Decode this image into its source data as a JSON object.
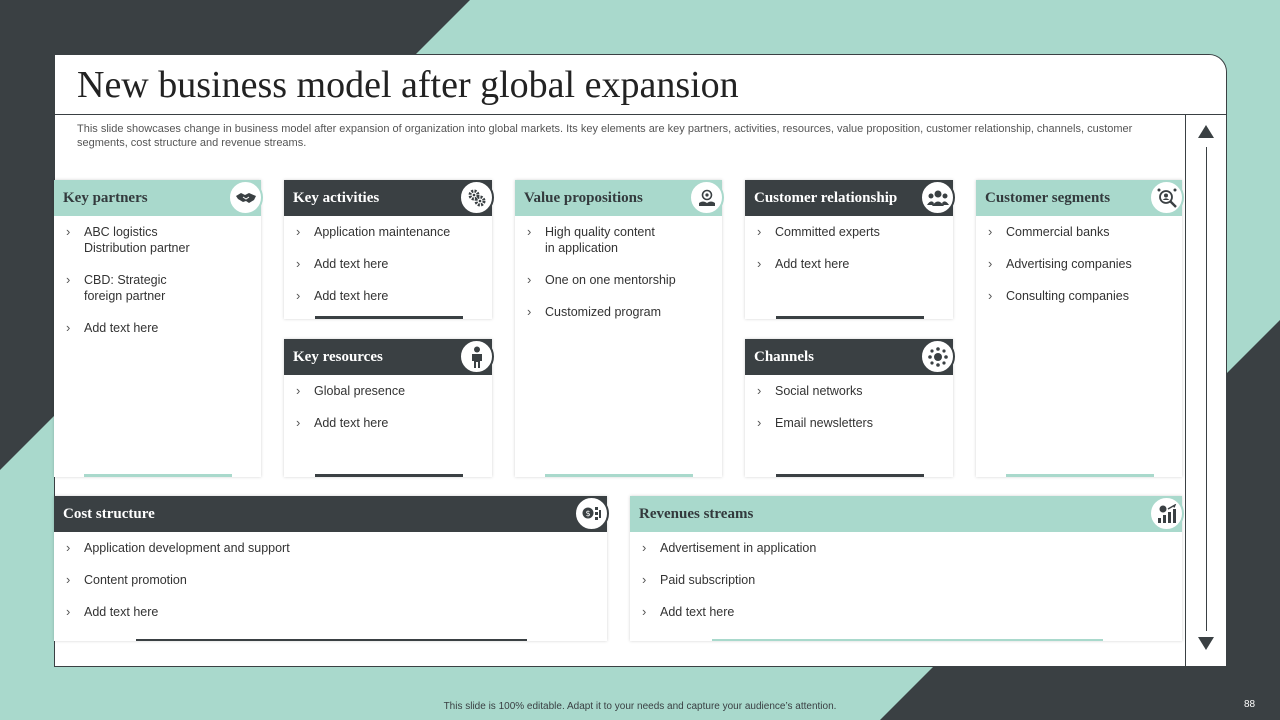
{
  "slide": {
    "title": "New business model after global expansion",
    "description": "This slide showcases change in business model after expansion of organization into global markets. Its key elements are key partners, activities, resources, value proposition, customer relationship, channels, customer segments, cost structure and revenue streams.",
    "footer_note": "This slide is 100% editable.  Adapt it to your needs and capture your audience’s attention.",
    "page_number": "88"
  },
  "colors": {
    "accent_mint": "#a9d9cc",
    "dark_slate": "#3a4043",
    "background_white": "#ffffff"
  },
  "cards": {
    "key_partners": {
      "title": "Key partners",
      "icon": "handshake-icon",
      "items": [
        "ABC logistics\nDistribution partner",
        "CBD: Strategic\nforeign  partner",
        "Add text here"
      ]
    },
    "key_activities": {
      "title": "Key activities",
      "icon": "gears-icon",
      "items": [
        "Application maintenance",
        "Add text here",
        "Add text here"
      ]
    },
    "key_resources": {
      "title": "Key resources",
      "icon": "person-icon",
      "items": [
        "Global presence",
        "Add text here"
      ]
    },
    "value_propositions": {
      "title": "Value propositions",
      "icon": "value-hand-icon",
      "items": [
        "High quality content\nin application",
        "One on one mentorship",
        "Customized program"
      ]
    },
    "customer_relationship": {
      "title": "Customer relationship",
      "icon": "customer-group-icon",
      "items": [
        "Committed experts",
        "Add text here"
      ]
    },
    "channels": {
      "title": "Channels",
      "icon": "network-icon",
      "items": [
        "Social networks",
        "Email newsletters"
      ]
    },
    "customer_segments": {
      "title": "Customer segments",
      "icon": "magnifier-people-icon",
      "items": [
        "Commercial banks",
        "Advertising companies",
        "Consulting companies"
      ]
    },
    "cost_structure": {
      "title": "Cost structure",
      "icon": "cost-icon",
      "items": [
        "Application development  and support",
        "Content promotion",
        "Add text here"
      ]
    },
    "revenue_streams": {
      "title": "Revenues streams",
      "icon": "growth-chart-icon",
      "items": [
        "Advertisement in application",
        "Paid subscription",
        "Add text here"
      ]
    }
  }
}
